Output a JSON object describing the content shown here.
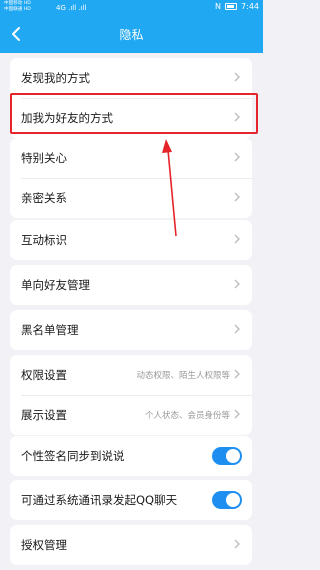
{
  "status_bar": {
    "carrier_1": "中国移动 HD",
    "carrier_2": "中国联通 HD",
    "time": "7:44",
    "signal": "4G .ıll .ıll"
  },
  "header": {
    "title": "隐私"
  },
  "rows": {
    "discover": "发现我的方式",
    "add_me": "加我为好友的方式",
    "special_care": "特别关心",
    "intimate": "亲密关系",
    "interaction": "互动标识",
    "one_way": "单向好友管理",
    "blacklist": "黑名单管理",
    "permissions": "权限设置",
    "permissions_value": "动态权限、陌生人权限等",
    "display": "展示设置",
    "display_value": "个人状态、会员身份等",
    "signature_sync": "个性签名同步到说说",
    "contacts_chat": "可通过系统通讯录发起QQ聊天",
    "auth": "授权管理"
  },
  "toggles": {
    "signature_sync": true,
    "contacts_chat": true
  },
  "colors": {
    "brand": "#20a8f3",
    "toggle_on": "#1e8ff1",
    "annotation": "#e5242b"
  }
}
